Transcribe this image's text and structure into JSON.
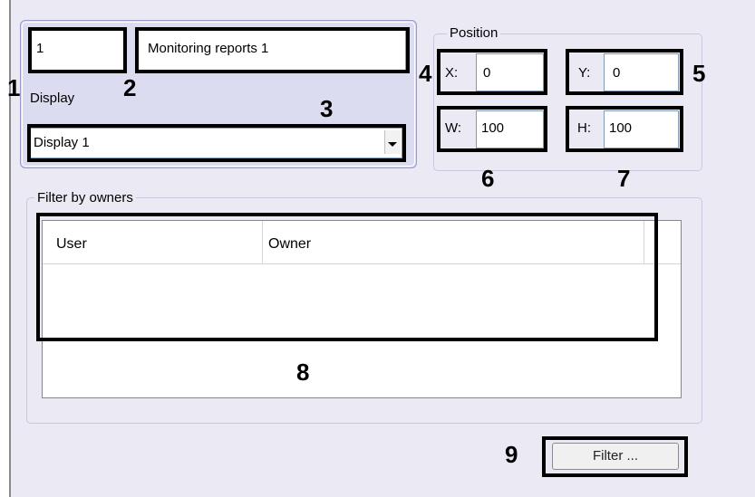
{
  "general": {
    "id_value": "1",
    "name_value": "Monitoring reports 1",
    "display_label": "Display",
    "display_value": "Display 1"
  },
  "position": {
    "legend": "Position",
    "x_label": "X:",
    "x_value": "0",
    "y_label": "Y:",
    "y_value": "0",
    "w_label": "W:",
    "w_value": "100",
    "h_label": "H:",
    "h_value": "100"
  },
  "filter": {
    "legend": "Filter by owners",
    "columns": [
      "User",
      "Owner"
    ],
    "button_label": "Filter ..."
  },
  "callouts": [
    "1",
    "2",
    "3",
    "4",
    "5",
    "6",
    "7",
    "8",
    "9"
  ],
  "icons": {
    "dropdown": "chevron-down-icon"
  }
}
